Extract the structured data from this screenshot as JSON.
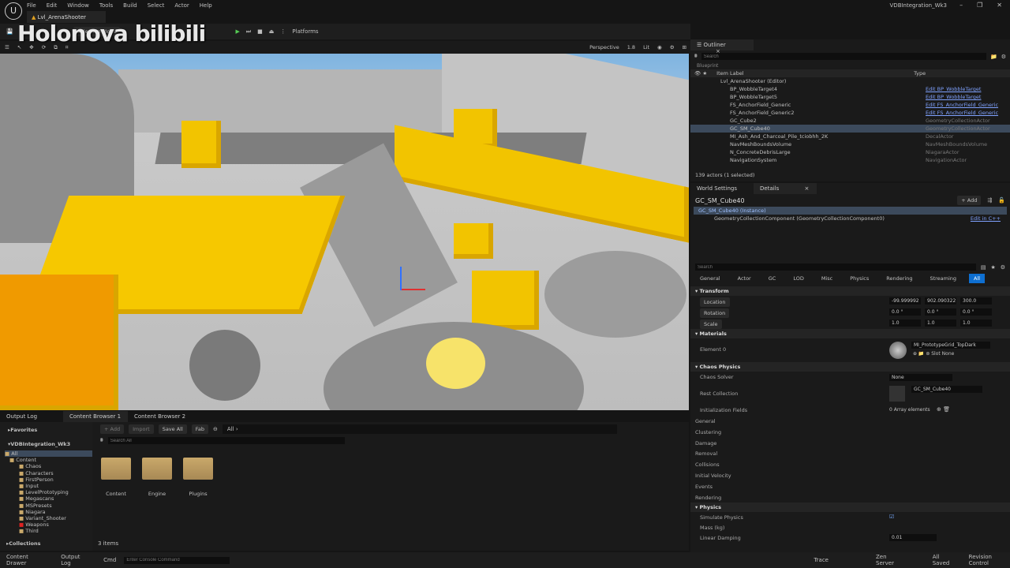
{
  "window": {
    "title": "VDBIntegration_Wk3",
    "level_tab": "Lvl_ArenaShooter",
    "engine_logo": "U"
  },
  "menu": [
    "File",
    "Edit",
    "Window",
    "Tools",
    "Build",
    "Select",
    "Actor",
    "Help"
  ],
  "toolbar": {
    "selection_mode": "Selection Mode",
    "platforms": "Platforms"
  },
  "watermark": "Holonova bilibili",
  "viewport_toolbar": {
    "perspective": "Perspective",
    "camera_speed": "1.8",
    "lit": "Lit"
  },
  "outliner": {
    "tab": "Outliner",
    "search_placeholder": "Search",
    "filter_chip": "Blueprint",
    "col_label": "Item Label",
    "col_type": "Type",
    "root": "Lvl_ArenaShooter (Editor)",
    "rows": [
      {
        "label": "BP_WobbleTarget4",
        "type": "Edit BP_WobbleTarget",
        "link": true
      },
      {
        "label": "BP_WobbleTarget5",
        "type": "Edit BP_WobbleTarget",
        "link": true
      },
      {
        "label": "FS_AnchorField_Generic",
        "type": "Edit FS_AnchorField_Generic",
        "link": true
      },
      {
        "label": "FS_AnchorField_Generic2",
        "type": "Edit FS_AnchorField_Generic",
        "link": true
      },
      {
        "label": "GC_Cube2",
        "type": "GeometryCollectionActor",
        "link": false
      },
      {
        "label": "GC_SM_Cube40",
        "type": "GeometryCollectionActor",
        "link": false,
        "selected": true
      },
      {
        "label": "MI_Ash_And_Charcoal_Pile_tciobhh_2K",
        "type": "DecalActor",
        "link": false
      },
      {
        "label": "NavMeshBoundsVolume",
        "type": "NavMeshBoundsVolume",
        "link": false
      },
      {
        "label": "N_ConcreteDebrisLarge",
        "type": "NiagaraActor",
        "link": false
      },
      {
        "label": "NavigationSystem",
        "type": "NavigationActor",
        "link": false
      }
    ],
    "footer": "139 actors (1 selected)"
  },
  "details": {
    "tab_world": "World Settings",
    "tab_details": "Details",
    "actor_name": "GC_SM_Cube40",
    "add": "+ Add",
    "instance": "GC_SM_Cube40 (Instance)",
    "component": "GeometryCollectionComponent (GeometryCollectionComponent0)",
    "edit_cpp": "Edit in C++",
    "search_placeholder": "Search",
    "categories": [
      "General",
      "Actor",
      "GC",
      "LOD",
      "Misc",
      "Physics",
      "Rendering",
      "Streaming",
      "All"
    ],
    "active_category": "All",
    "transform": {
      "title": "Transform",
      "location": {
        "label": "Location",
        "x": "-99.999992",
        "y": "902.090322",
        "z": "300.0"
      },
      "rotation": {
        "label": "Rotation",
        "x": "0.0 °",
        "y": "0.0 °",
        "z": "0.0 °"
      },
      "scale": {
        "label": "Scale",
        "x": "1.0",
        "y": "1.0",
        "z": "1.0"
      }
    },
    "materials": {
      "title": "Materials",
      "element": "Element 0",
      "material": "MI_PrototypeGrid_TopDark",
      "slot_label": "Slot",
      "slot_value": "None"
    },
    "chaos": {
      "title": "Chaos Physics",
      "solver_label": "Chaos Solver",
      "solver_value": "None",
      "rest_label": "Rest Collection",
      "rest_value": "GC_SM_Cube40",
      "init_label": "Initialization Fields",
      "init_value": "0 Array elements"
    },
    "collapsed": [
      "General",
      "Clustering",
      "Damage",
      "Removal",
      "Collisions",
      "Initial Velocity",
      "Events",
      "Rendering"
    ],
    "physics": {
      "title": "Physics",
      "simulate": "Simulate Physics",
      "simulate_checked": true,
      "mass": "Mass (kg)",
      "linear_label": "Linear Damping",
      "linear_value": "0.01"
    }
  },
  "bottom_tabs": [
    "Output Log",
    "Content Browser 1",
    "Content Browser 2"
  ],
  "content": {
    "favorites": "Favorites",
    "project": "VDBIntegration_Wk3",
    "tree": [
      "All",
      "Content",
      "Chaos",
      "Characters",
      "FirstPerson",
      "Input",
      "LevelPrototyping",
      "Megascans",
      "MSPresets",
      "Niagara",
      "Variant_Shooter",
      "Weapons",
      "Third"
    ],
    "collections": "Collections",
    "add": "+ Add",
    "import": "Import",
    "save_all": "Save All",
    "fab": "Fab",
    "path": "All",
    "search_placeholder": "Search All",
    "folders": [
      "Content",
      "Engine",
      "Plugins"
    ],
    "count": "3 items"
  },
  "status": {
    "content_drawer": "Content Drawer",
    "output_log": "Output Log",
    "cmd": "Cmd",
    "cmd_placeholder": "Enter Console Command",
    "trace": "Trace",
    "zen": "Zen Server",
    "saved": "All Saved",
    "revision": "Revision Control"
  },
  "colors": {
    "accent": "#0e6fd1",
    "selection": "#3c4a5c",
    "link": "#7fa2ff",
    "folder": "#c9a86a"
  }
}
